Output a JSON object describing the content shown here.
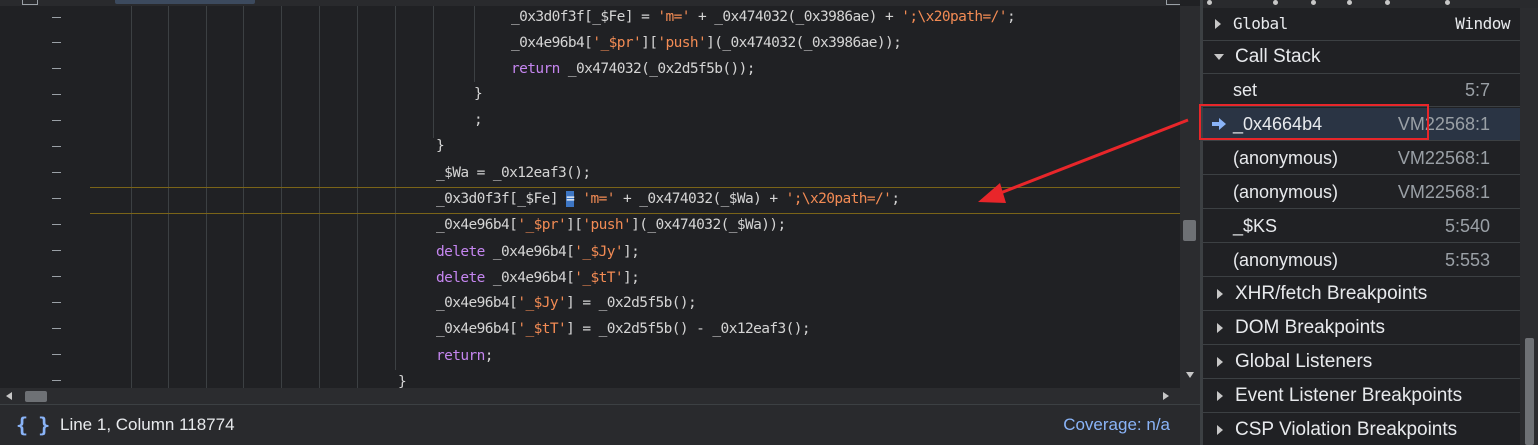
{
  "editor": {
    "code_lines": [
      [
        {
          "t": "_0x3d0f3f[_$Fe] = ",
          "c": "plain"
        },
        {
          "t": "'m='",
          "c": "str"
        },
        {
          "t": " + _0x474032(_0x3986ae) + ",
          "c": "plain"
        },
        {
          "t": "';\\x20path=/'",
          "c": "str"
        },
        {
          "t": ";",
          "c": "plain"
        }
      ],
      [
        {
          "t": "_0x4e96b4[",
          "c": "plain"
        },
        {
          "t": "'_$pr'",
          "c": "str"
        },
        {
          "t": "][",
          "c": "plain"
        },
        {
          "t": "'push'",
          "c": "str"
        },
        {
          "t": "](_0x474032(_0x3986ae));",
          "c": "plain"
        }
      ],
      [
        {
          "t": "return",
          "c": "kw"
        },
        {
          "t": " _0x474032(_0x2d5f5b());",
          "c": "plain"
        }
      ],
      [
        {
          "t": "}",
          "c": "plain"
        }
      ],
      [
        {
          "t": ";",
          "c": "plain"
        }
      ],
      [
        {
          "t": "}",
          "c": "plain"
        }
      ],
      [
        {
          "t": "_$Wa = _0x12eaf3();",
          "c": "plain"
        }
      ],
      [
        {
          "t": "_0x3d0f3f[_$Fe] ",
          "c": "plain"
        },
        {
          "t": "=",
          "c": "cursor"
        },
        {
          "t": " ",
          "c": "plain"
        },
        {
          "t": "'m='",
          "c": "str"
        },
        {
          "t": " + _0x474032(_$Wa) + ",
          "c": "plain"
        },
        {
          "t": "';\\x20path=/'",
          "c": "str"
        },
        {
          "t": ";",
          "c": "plain"
        }
      ],
      [
        {
          "t": "_0x4e96b4[",
          "c": "plain"
        },
        {
          "t": "'_$pr'",
          "c": "str"
        },
        {
          "t": "][",
          "c": "plain"
        },
        {
          "t": "'push'",
          "c": "str"
        },
        {
          "t": "](_0x474032(_$Wa));",
          "c": "plain"
        }
      ],
      [
        {
          "t": "delete",
          "c": "kw"
        },
        {
          "t": " _0x4e96b4[",
          "c": "plain"
        },
        {
          "t": "'_$Jy'",
          "c": "str"
        },
        {
          "t": "];",
          "c": "plain"
        }
      ],
      [
        {
          "t": "delete",
          "c": "kw"
        },
        {
          "t": " _0x4e96b4[",
          "c": "plain"
        },
        {
          "t": "'_$tT'",
          "c": "str"
        },
        {
          "t": "];",
          "c": "plain"
        }
      ],
      [
        {
          "t": "_0x4e96b4[",
          "c": "plain"
        },
        {
          "t": "'_$Jy'",
          "c": "str"
        },
        {
          "t": "] = _0x2d5f5b();",
          "c": "plain"
        }
      ],
      [
        {
          "t": "_0x4e96b4[",
          "c": "plain"
        },
        {
          "t": "'_$tT'",
          "c": "str"
        },
        {
          "t": "] = _0x2d5f5b() - _0x12eaf3();",
          "c": "plain"
        }
      ],
      [
        {
          "t": "return",
          "c": "kw"
        },
        {
          "t": ";",
          "c": "plain"
        }
      ],
      [
        {
          "t": "}",
          "c": "plain"
        }
      ]
    ]
  },
  "statusbar": {
    "position": "Line 1, Column 118774",
    "coverage": "Coverage: n/a"
  },
  "sidebar": {
    "global": {
      "label": "Global",
      "value": "Window"
    },
    "call_stack_title": "Call Stack",
    "frames": [
      {
        "name": "set",
        "location": "5:7",
        "current": false
      },
      {
        "name": "_0x4664b4",
        "location": "VM22568:1",
        "current": true
      },
      {
        "name": "(anonymous)",
        "location": "VM22568:1",
        "current": false
      },
      {
        "name": "(anonymous)",
        "location": "VM22568:1",
        "current": false
      },
      {
        "name": "_$KS",
        "location": "5:540",
        "current": false
      },
      {
        "name": "(anonymous)",
        "location": "5:553",
        "current": false
      }
    ],
    "sections": [
      "XHR/fetch Breakpoints",
      "DOM Breakpoints",
      "Global Listeners",
      "Event Listener Breakpoints",
      "CSP Violation Breakpoints"
    ]
  },
  "colors": {
    "accent": "#8ab4f8",
    "annotation": "#e8262a",
    "string": "#f28b54",
    "keyword": "#c586f0"
  }
}
